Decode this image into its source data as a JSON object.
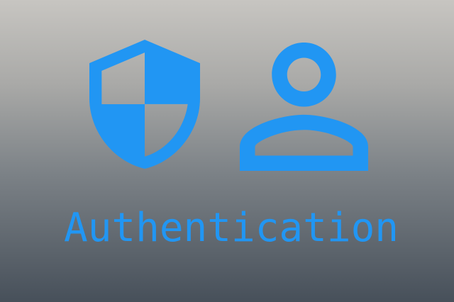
{
  "icons": [
    {
      "name": "security-shield-icon",
      "color": "#2196f3"
    },
    {
      "name": "person-outline-icon",
      "color": "#2196f3"
    }
  ],
  "title": "Authentication",
  "colors": {
    "accent": "#2196f3",
    "background_top": "#c7c5c1",
    "background_bottom": "#47505a"
  }
}
